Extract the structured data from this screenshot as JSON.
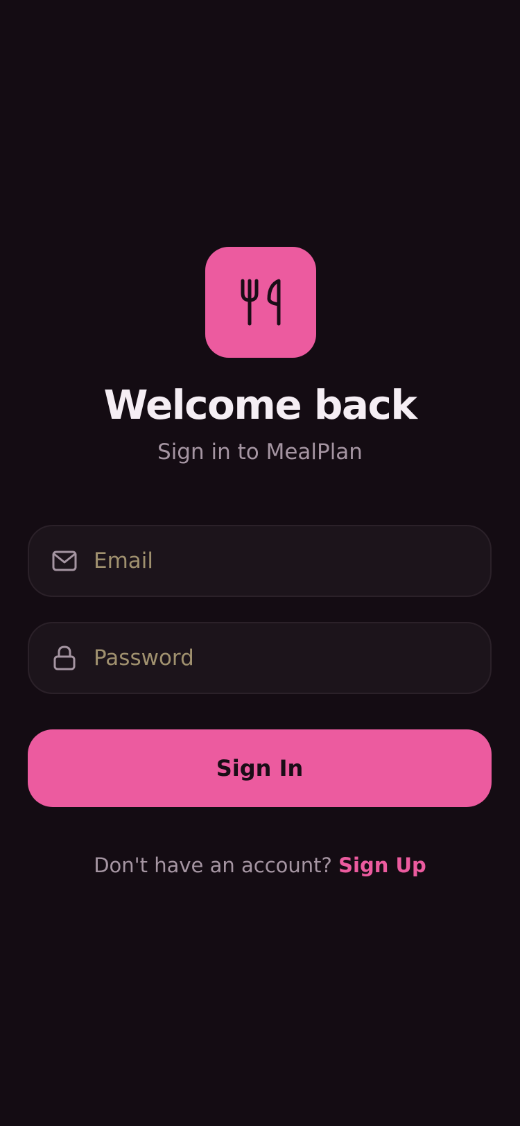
{
  "app": {
    "name": "MealPlan",
    "logo_icon": "fork-knife-icon"
  },
  "header": {
    "title": "Welcome back",
    "subtitle": "Sign in to MealPlan"
  },
  "form": {
    "email": {
      "icon": "mail-icon",
      "value": "",
      "placeholder": "Email"
    },
    "password": {
      "icon": "lock-icon",
      "value": "",
      "placeholder": "Password"
    },
    "submit_label": "Sign In"
  },
  "footer": {
    "prompt": "Don't have an account?",
    "link_label": "Sign Up"
  },
  "colors": {
    "background": "#140c13",
    "accent": "#ec5b9f",
    "field_background": "#1c141b",
    "field_border": "#2b2129",
    "title_text": "#f5eef4",
    "muted_text": "#a595a2",
    "placeholder_text": "#a0916f"
  }
}
